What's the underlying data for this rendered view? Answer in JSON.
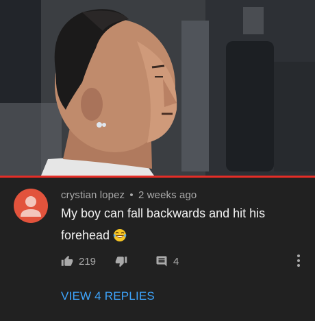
{
  "comment": {
    "author": "crystian lopez",
    "separator": "•",
    "timestamp": "2 weeks ago",
    "text": "My boy can fall backwards and hit his forehead",
    "emoji": "laughing-tears-emoji",
    "like_count": "219",
    "reply_count": "4",
    "view_replies_label": "VIEW 4 REPLIES"
  },
  "video": {
    "progress": 1.0
  },
  "icons": {
    "avatar": "default-person-avatar",
    "like": "thumbs-up-icon",
    "dislike": "thumbs-down-icon",
    "reply": "comment-reply-icon",
    "more": "more-vertical-icon"
  },
  "colors": {
    "background": "#212121",
    "progress": "#e52d27",
    "avatar": "#e2533c",
    "link": "#3ea6ff",
    "secondary_text": "#aaaaaa",
    "primary_text": "#f1f1f1"
  }
}
